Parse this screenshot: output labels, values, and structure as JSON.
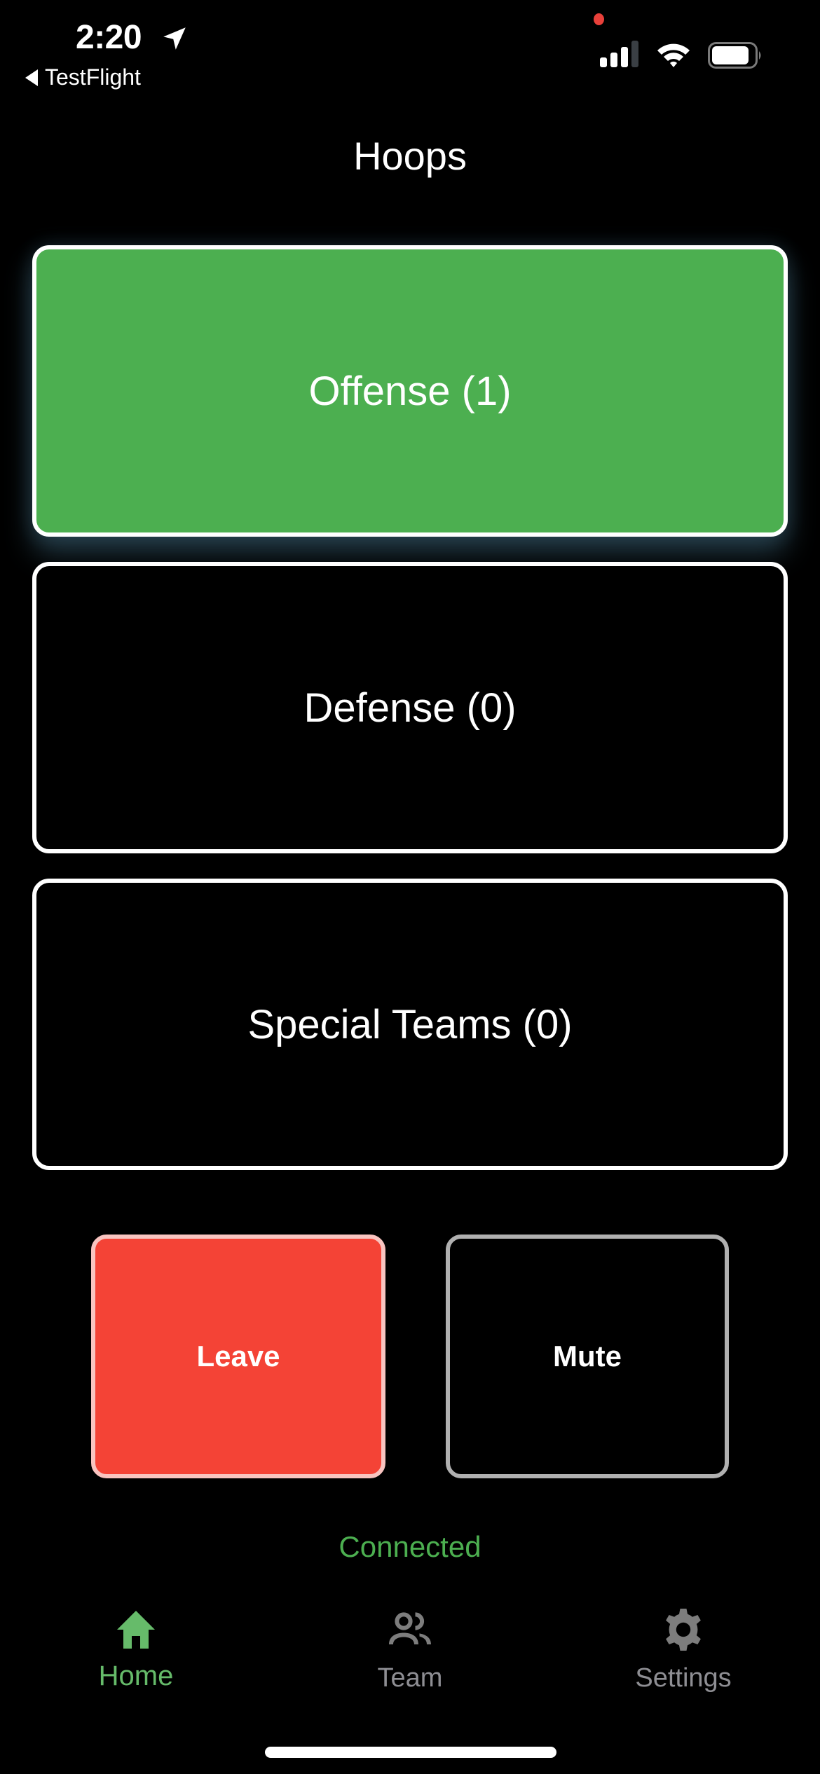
{
  "status_bar": {
    "time": "2:20",
    "back_app": "TestFlight",
    "icons": [
      "location-arrow-icon",
      "recording-dot-icon",
      "cellular-signal-icon",
      "wifi-icon",
      "battery-icon"
    ]
  },
  "header": {
    "title": "Hoops"
  },
  "groups": [
    {
      "label": "Offense (1)",
      "name": "Offense",
      "count": 1,
      "active": true
    },
    {
      "label": "Defense (0)",
      "name": "Defense",
      "count": 0,
      "active": false
    },
    {
      "label": "Special Teams (0)",
      "name": "Special Teams",
      "count": 0,
      "active": false
    }
  ],
  "actions": {
    "leave_label": "Leave",
    "mute_label": "Mute"
  },
  "connection": {
    "status": "Connected"
  },
  "tabs": [
    {
      "label": "Home",
      "icon": "home-icon",
      "active": true
    },
    {
      "label": "Team",
      "icon": "people-icon",
      "active": false
    },
    {
      "label": "Settings",
      "icon": "gear-icon",
      "active": false
    }
  ],
  "colors": {
    "accent_green": "#4caf50",
    "tab_active": "#66bb6a",
    "tab_inactive": "#8e8e93",
    "leave_red": "#f44336",
    "leave_border": "#f9c4c0",
    "mute_border": "#b0b0b0",
    "background": "#000000"
  }
}
